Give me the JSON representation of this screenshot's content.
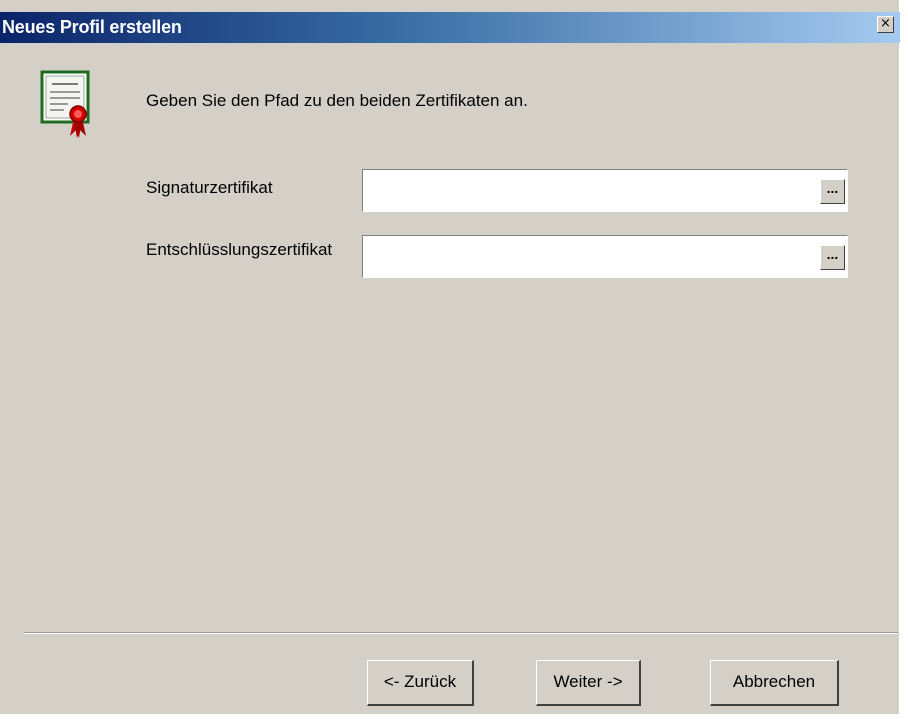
{
  "window": {
    "title": "Neues Profil erstellen",
    "close_glyph": "×"
  },
  "icon": "certificate-icon",
  "instruction": "Geben Sie den Pfad zu den beiden Zertifikaten an.",
  "fields": {
    "signature": {
      "label": "Signaturzertifikat",
      "value": "",
      "browse_label": "..."
    },
    "encryption": {
      "label": "Entschlüsslungszertifikat",
      "value": "",
      "browse_label": "..."
    }
  },
  "buttons": {
    "back": "<- Zurück",
    "next": "Weiter ->",
    "cancel": "Abbrechen"
  },
  "colors": {
    "titlebar_start": "#0a246a",
    "titlebar_end": "#a6caf0",
    "dialog_background": "#d4d0c8"
  }
}
